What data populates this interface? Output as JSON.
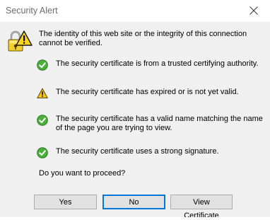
{
  "window": {
    "title": "Security Alert"
  },
  "header": {
    "text": "The identity of this web site or the integrity of this connection cannot be verified."
  },
  "checks": [
    {
      "status": "ok",
      "text": "The security certificate is from a trusted certifying authority."
    },
    {
      "status": "warning",
      "text": "The security certificate has expired or is not yet valid."
    },
    {
      "status": "ok",
      "text": "The security certificate has a valid name matching the name of the page you are trying to view."
    },
    {
      "status": "ok",
      "text": "The security certificate uses a strong signature."
    }
  ],
  "question": "Do you want to proceed?",
  "buttons": {
    "yes": "Yes",
    "no": "No",
    "view_certificate": "View Certificate"
  },
  "icons": {
    "header": "padlock-warning-icon",
    "ok": "green-check-icon",
    "warning": "warning-triangle-icon",
    "close": "close-icon"
  },
  "colors": {
    "ok_green": "#3b9c2c",
    "warning_yellow": "#f5c518",
    "default_button_border": "#0078d7"
  }
}
